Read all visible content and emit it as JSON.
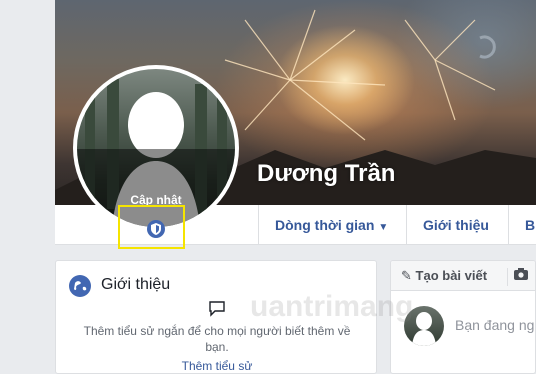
{
  "profile": {
    "name": "Dương Trần",
    "update_photo_label": "Cập nhật"
  },
  "nav": {
    "tabs": [
      {
        "label": "Dòng thời gian",
        "has_dropdown": true
      },
      {
        "label": "Giới thiệu"
      },
      {
        "label": "B"
      }
    ]
  },
  "intro": {
    "title": "Giới thiệu",
    "description": "Thêm tiểu sử ngắn để cho mọi người biết thêm về bạn.",
    "link": "Thêm tiểu sử"
  },
  "composer": {
    "tabs": [
      {
        "label": "Tạo bài viết",
        "icon": "pencil-icon"
      },
      {
        "label": "",
        "icon": "camera-icon"
      }
    ],
    "placeholder": "Bạn đang ng"
  },
  "watermark": "uantrimang",
  "colors": {
    "link_blue": "#365899",
    "brand_blue": "#4267b2",
    "highlight_yellow": "#f5e400"
  }
}
